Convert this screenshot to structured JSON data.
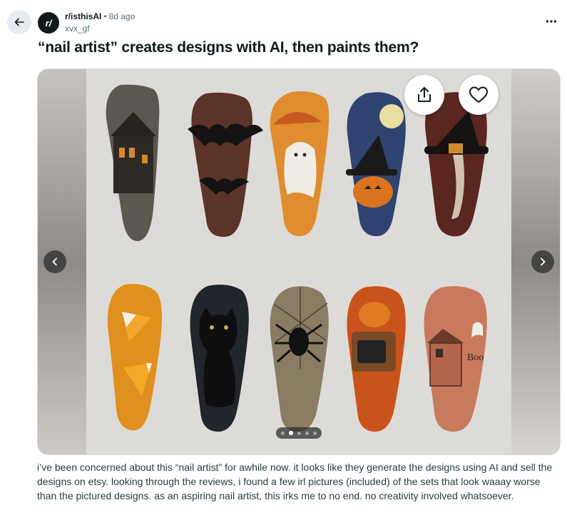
{
  "header": {
    "subreddit": "r/isthisAI",
    "separator": "•",
    "time_ago": "8d ago",
    "author": "xvx_gf",
    "avatar_text": "r/"
  },
  "post": {
    "title": "“nail artist” creates designs with AI, then paints them?",
    "body": "i’ve been concerned about this “nail artist” for awhile now. it looks like they generate the designs using AI and sell the designs on etsy. looking through the reviews, i found a few irl pictures (included) of the sets that look waaay worse than the pictured designs. as an aspiring nail artist, this irks me to no end. no creativity involved whatsoever."
  },
  "gallery": {
    "total_images": 5,
    "current_index": 2,
    "image_text": "Boo"
  },
  "icons": {
    "back": "arrow-left-icon",
    "more": "more-horizontal-icon",
    "share": "share-icon",
    "like": "heart-icon",
    "prev": "chevron-left-icon",
    "next": "chevron-right-icon"
  },
  "colors": {
    "text_primary": "#0f1a1c",
    "text_secondary": "#576f76",
    "back_button_bg": "#e5ebee"
  }
}
